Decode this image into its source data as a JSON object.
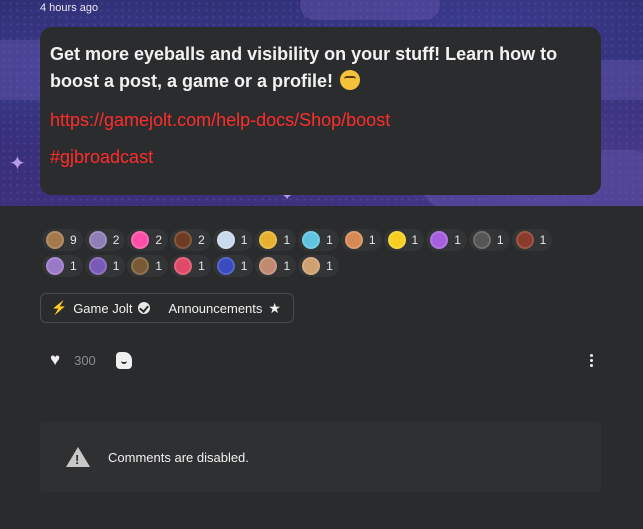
{
  "post": {
    "timestamp": "4 hours ago",
    "lead": "Get more eyeballs and visibility on your stuff! Learn how to boost a post, a game or a profile!",
    "link": "https://gamejolt.com/help-docs/Shop/boost",
    "hashtag": "#gjbroadcast"
  },
  "reactions": [
    [
      {
        "count": "9",
        "color": "#a57a4a"
      },
      {
        "count": "2",
        "color": "#8f7db5"
      },
      {
        "count": "2",
        "color": "#ff4fa8"
      },
      {
        "count": "2",
        "color": "#6b3b22"
      },
      {
        "count": "1",
        "color": "#c9d9ee"
      },
      {
        "count": "1",
        "color": "#e8b030"
      },
      {
        "count": "1",
        "color": "#5fc4e0"
      },
      {
        "count": "1",
        "color": "#d88a55"
      },
      {
        "count": "1",
        "color": "#f5d020"
      },
      {
        "count": "1",
        "color": "#a45fe0"
      },
      {
        "count": "1",
        "color": "#555555"
      },
      {
        "count": "1",
        "color": "#8a3b2a"
      }
    ],
    [
      {
        "count": "1",
        "color": "#9a7ac8"
      },
      {
        "count": "1",
        "color": "#7a5ab8"
      },
      {
        "count": "1",
        "color": "#7a5a36"
      },
      {
        "count": "1",
        "color": "#e04a6a"
      },
      {
        "count": "1",
        "color": "#3a4ac0"
      },
      {
        "count": "1",
        "color": "#c08a70"
      },
      {
        "count": "1",
        "color": "#d0a070"
      }
    ]
  ],
  "community": {
    "name": "Game Jolt",
    "channel": "Announcements"
  },
  "actions": {
    "like_count": "300"
  },
  "comments": {
    "disabled_text": "Comments are disabled."
  }
}
